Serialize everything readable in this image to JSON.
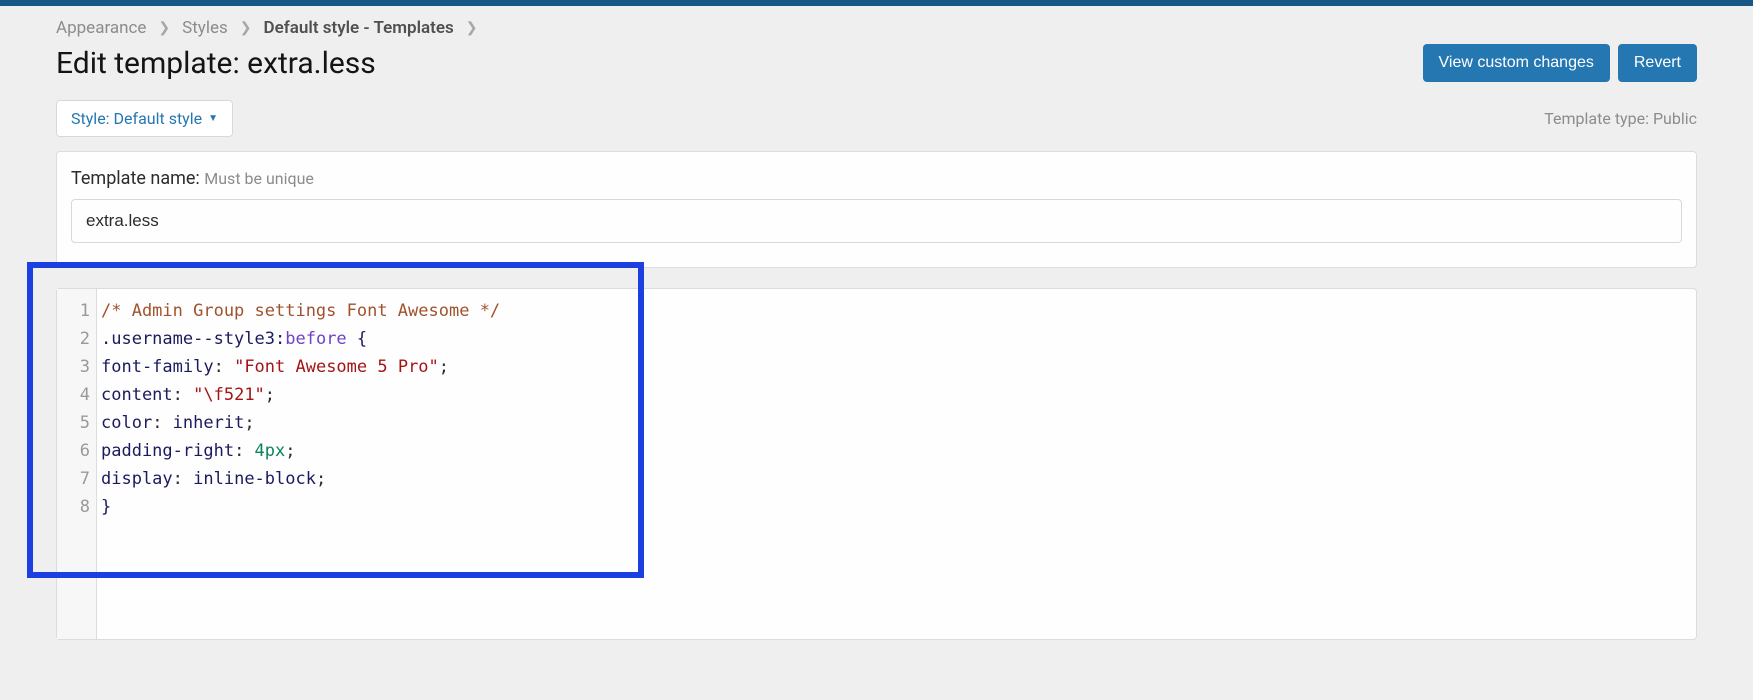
{
  "breadcrumb": {
    "appearance": "Appearance",
    "styles": "Styles",
    "current": "Default style - Templates"
  },
  "page_title": "Edit template: extra.less",
  "buttons": {
    "view_changes": "View custom changes",
    "revert": "Revert"
  },
  "style_selector": "Style: Default style",
  "template_type": "Template type: Public",
  "template_name": {
    "label": "Template name:",
    "hint": "Must be unique",
    "value": "extra.less"
  },
  "line_numbers": [
    "1",
    "2",
    "3",
    "4",
    "5",
    "6",
    "7",
    "8"
  ],
  "code": {
    "l1": {
      "comment": "/* Admin Group settings Font Awesome */"
    },
    "l2": {
      "selector": ".username--style3",
      "colon": ":",
      "pseudo": "before",
      "sp": " ",
      "brace": "{"
    },
    "l3": {
      "prop": "font-family",
      "colon": ": ",
      "string": "\"Font Awesome 5 Pro\"",
      "semi": ";"
    },
    "l4": {
      "prop": "content",
      "colon": ": ",
      "string": "\"\\f521\"",
      "semi": ";"
    },
    "l5": {
      "prop": "color",
      "colon": ": ",
      "val": "inherit",
      "semi": ";"
    },
    "l6": {
      "prop": "padding-right",
      "colon": ": ",
      "unit": "4px",
      "semi": ";"
    },
    "l7": {
      "prop": "display",
      "colon": ": ",
      "val": "inline-block",
      "semi": ";"
    },
    "l8": {
      "brace": "}"
    }
  }
}
